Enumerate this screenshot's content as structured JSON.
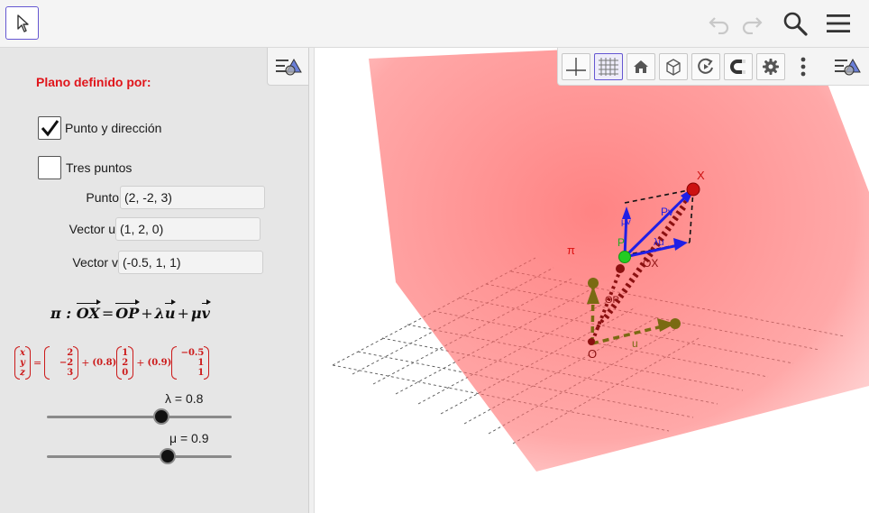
{
  "app": {
    "toolbar": {
      "active_tool": "move-tool"
    },
    "top_icons": [
      "undo-icon",
      "redo-icon",
      "search-icon",
      "menu-icon"
    ]
  },
  "algebra": {
    "title": "Plano definido por:",
    "checkboxes": [
      {
        "label": "Punto y dirección",
        "checked": true
      },
      {
        "label": "Tres puntos",
        "checked": false
      }
    ],
    "inputs": [
      {
        "label": "Punto",
        "value": "(2, -2, 3)"
      },
      {
        "label": "Vector u",
        "value": "(1, 2, 0)"
      },
      {
        "label": "Vector v",
        "value": "(-0.5, 1, 1)"
      }
    ],
    "formula": {
      "lhs": "π : ",
      "ox": "OX",
      "eq": "=",
      "op": "OP",
      "plus1": "+",
      "lambda": "λ",
      "u": "u",
      "plus2": "+",
      "mu": "μ",
      "v": "v"
    },
    "matrix": {
      "xyz": [
        "x",
        "y",
        "z"
      ],
      "eq": "=",
      "p": [
        "2",
        "−2",
        "3"
      ],
      "plus1": "+",
      "lambda_coef": "(0.8)",
      "u": [
        "1",
        "2",
        "0"
      ],
      "plus2": "+",
      "mu_coef": "(0.9)",
      "v": [
        "−0.5",
        "1",
        "1"
      ]
    },
    "sliders": [
      {
        "label": "λ = 0.8",
        "value": 0.8,
        "min": -1,
        "max": 1
      },
      {
        "label": "μ = 0.9",
        "value": 0.9,
        "min": -1,
        "max": 1
      }
    ]
  },
  "graphics": {
    "toolbar_icons": [
      "axes-icon",
      "grid-icon",
      "home-icon",
      "cube-view-icon",
      "rotate-icon",
      "magnet-icon",
      "gear-icon",
      "more-icon",
      "style-bar-icon"
    ],
    "labels": {
      "plane": "π",
      "point_x": "X",
      "point_p": "P",
      "origin": "O",
      "vec_u_gray": "u",
      "vec_ox": "OX",
      "vec_op": "OP",
      "vec_lu": "λu",
      "vec_mv": "μv",
      "vec_pv": "Pv"
    },
    "colors": {
      "plane": "#ff5a5a",
      "vector_blue": "#1f1fe6",
      "dark_red": "#8b1010",
      "olive": "#7a6a12",
      "point_green": "#22cc22",
      "point_red": "#cc1111"
    }
  }
}
